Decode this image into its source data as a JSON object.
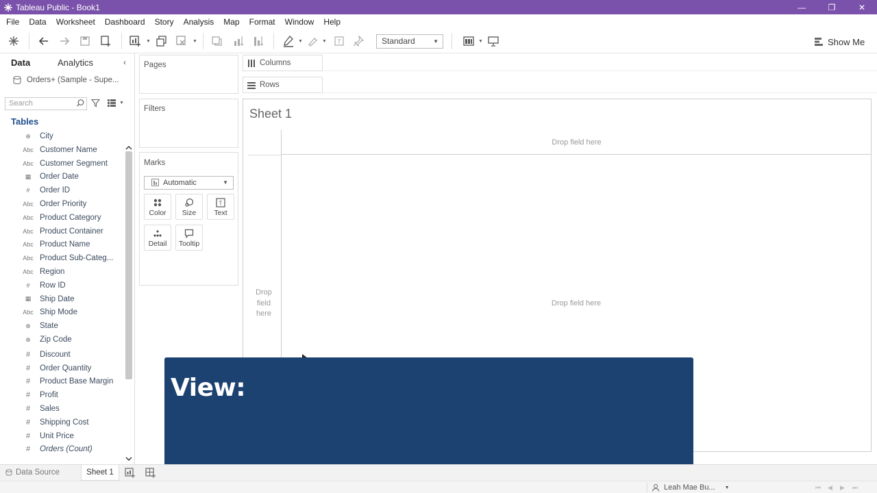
{
  "window": {
    "title": "Tableau Public - Book1",
    "controls": [
      "—",
      "❐",
      "✕"
    ]
  },
  "menu": [
    "File",
    "Data",
    "Worksheet",
    "Dashboard",
    "Story",
    "Analysis",
    "Map",
    "Format",
    "Window",
    "Help"
  ],
  "toolbar": {
    "fit": "Standard",
    "show_me": "Show Me"
  },
  "data_pane": {
    "tabs": {
      "data": "Data",
      "analytics": "Analytics"
    },
    "datasource": "Orders+ (Sample - Supe...",
    "search_placeholder": "Search",
    "tables_heading": "Tables",
    "fields": [
      {
        "type": "geo",
        "icon": "⊕",
        "name": "City"
      },
      {
        "type": "abc",
        "icon": "Abc",
        "name": "Customer Name"
      },
      {
        "type": "abc",
        "icon": "Abc",
        "name": "Customer Segment"
      },
      {
        "type": "date",
        "icon": "▦",
        "name": "Order Date"
      },
      {
        "type": "num",
        "icon": "#",
        "name": "Order ID"
      },
      {
        "type": "abc",
        "icon": "Abc",
        "name": "Order Priority"
      },
      {
        "type": "abc",
        "icon": "Abc",
        "name": "Product Category"
      },
      {
        "type": "abc",
        "icon": "Abc",
        "name": "Product Container"
      },
      {
        "type": "abc",
        "icon": "Abc",
        "name": "Product Name"
      },
      {
        "type": "abc",
        "icon": "Abc",
        "name": "Product Sub-Categ..."
      },
      {
        "type": "abc",
        "icon": "Abc",
        "name": "Region"
      },
      {
        "type": "num",
        "icon": "#",
        "name": "Row ID"
      },
      {
        "type": "date",
        "icon": "▦",
        "name": "Ship Date"
      },
      {
        "type": "abc",
        "icon": "Abc",
        "name": "Ship Mode"
      },
      {
        "type": "geo",
        "icon": "⊕",
        "name": "State"
      },
      {
        "type": "geo",
        "icon": "⊕",
        "name": "Zip Code"
      },
      {
        "type": "measure",
        "icon": "#",
        "name": "Discount"
      },
      {
        "type": "measure",
        "icon": "#",
        "name": "Order Quantity"
      },
      {
        "type": "measure",
        "icon": "#",
        "name": "Product Base Margin"
      },
      {
        "type": "measure",
        "icon": "#",
        "name": "Profit"
      },
      {
        "type": "measure",
        "icon": "#",
        "name": "Sales"
      },
      {
        "type": "measure",
        "icon": "#",
        "name": "Shipping Cost"
      },
      {
        "type": "measure",
        "icon": "#",
        "name": "Unit Price"
      },
      {
        "type": "measure",
        "icon": "#",
        "name": "Orders (Count)",
        "italic": true
      }
    ]
  },
  "cards": {
    "pages": "Pages",
    "filters": "Filters",
    "marks": "Marks",
    "mark_type": "Automatic",
    "mark_buttons": {
      "color": "Color",
      "size": "Size",
      "text": "Text",
      "detail": "Detail",
      "tooltip": "Tooltip"
    }
  },
  "shelves": {
    "columns": "Columns",
    "rows": "Rows"
  },
  "view": {
    "sheet_title": "Sheet 1",
    "drop_top": "Drop field here",
    "drop_left": [
      "Drop",
      "field",
      "here"
    ],
    "drop_center": "Drop field here"
  },
  "overlay": {
    "text": "View:"
  },
  "bottom_tabs": {
    "datasource": "Data Source",
    "sheet": "Sheet 1"
  },
  "status": {
    "user": "Leah Mae Bu..."
  }
}
